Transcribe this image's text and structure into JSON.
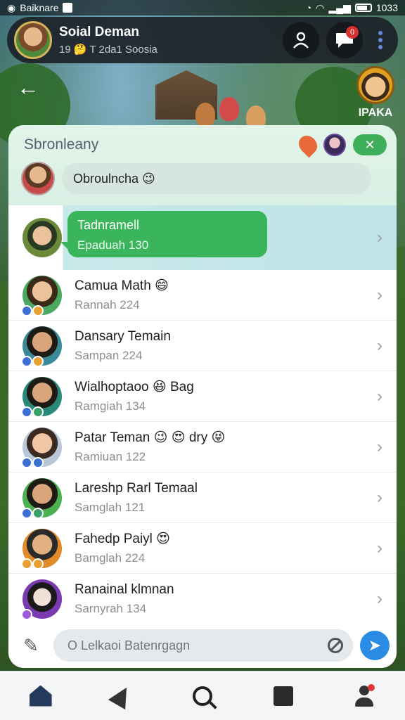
{
  "status_bar": {
    "app_name": "Baiknare",
    "time": "1033"
  },
  "header": {
    "title": "Soial Deman",
    "subtitle": "19 🤔 T 2da1 Soosia",
    "message_badge": "0"
  },
  "corner_logo_text": "IPAKA",
  "panel": {
    "title": "Sbronleany",
    "compose_text": "Obroulncha 😉"
  },
  "featured": {
    "name": "Tadnramell",
    "sub": "Epaduah 130"
  },
  "contacts": [
    {
      "name": "Camua Math 😄",
      "sub": "Rannah 224"
    },
    {
      "name": "Dansary Temain",
      "sub": "Sampan 224"
    },
    {
      "name": "Wialhoptaoo 😆 Bag",
      "sub": "Ramgiah 134"
    },
    {
      "name": "Patar Teman 😉 😍 dry 😝",
      "sub": "Ramiuan 122"
    },
    {
      "name": "Lareshp Rarl Temaal",
      "sub": "Samglah 121"
    },
    {
      "name": "Fahedp Paiyl 😍",
      "sub": "Bamglah 224"
    },
    {
      "name": "Ranainal klmnan",
      "sub": "Sarnyrah 134"
    }
  ],
  "input": {
    "placeholder": "O Lelkaoi Batenrgagn"
  },
  "colors": {
    "accent_green": "#3bb55c",
    "send_blue": "#2b8ce6",
    "badge_red": "#d93030"
  },
  "icons": [
    "back-arrow-icon",
    "user-icon",
    "chat-icon",
    "more-vertical-icon",
    "pin-icon",
    "close-icon",
    "edit-icon",
    "clear-icon",
    "send-icon",
    "home-icon",
    "paper-plane-icon",
    "search-icon",
    "square-icon",
    "profile-icon"
  ]
}
